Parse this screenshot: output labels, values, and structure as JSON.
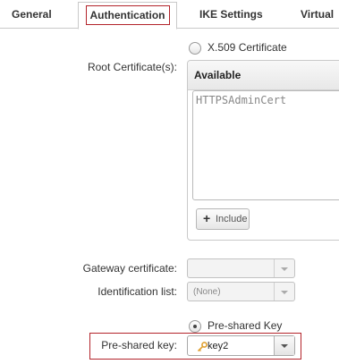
{
  "tabs": [
    {
      "label": "General"
    },
    {
      "label": "Authentication"
    },
    {
      "label": "IKE Settings"
    },
    {
      "label": "Virtual"
    }
  ],
  "x509": {
    "option_label": "X.509 Certificate"
  },
  "root_certificates": {
    "label": "Root Certificate(s):",
    "panel_header": "Available",
    "items": [
      "HTTPSAdminCert"
    ],
    "include_button": "Include"
  },
  "gateway_certificate": {
    "label": "Gateway certificate:",
    "value": ""
  },
  "identification_list": {
    "label": "Identification list:",
    "value": "(None)"
  },
  "psk": {
    "option_label": "Pre-shared Key",
    "field_label": "Pre-shared key:",
    "value": "key2"
  },
  "colors": {
    "highlight": "#b3242b",
    "key_icon": "#e0a030"
  }
}
